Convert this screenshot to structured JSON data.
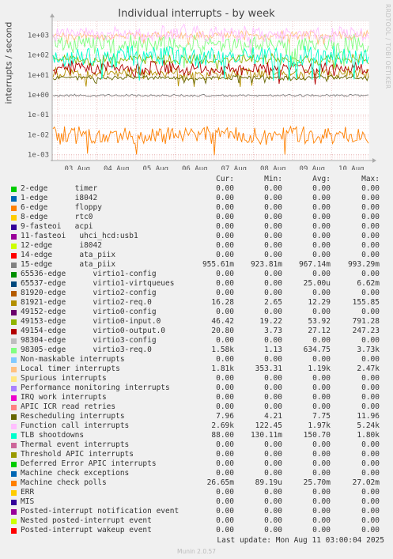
{
  "chart_data": {
    "type": "line",
    "title": "Individual interrupts - by week",
    "ylabel": "interrupts / second",
    "yscale": "log",
    "ylim": [
      0.0005,
      5000
    ],
    "yticks": [
      "1e-03",
      "1e-02",
      "1e-01",
      "1e+00",
      "1e+01",
      "1e+02",
      "1e+03"
    ],
    "xticks": [
      "03 Aug",
      "04 Aug",
      "05 Aug",
      "06 Aug",
      "07 Aug",
      "08 Aug",
      "09 Aug",
      "10 Aug"
    ],
    "grid": true,
    "legend_header": {
      "cur": "Cur:",
      "min": "Min:",
      "avg": "Avg:",
      "max": "Max:"
    },
    "series": [
      {
        "name": "2-edge      timer",
        "color": "#00cc00",
        "cur": "0.00",
        "min": "0.00",
        "avg": "0.00",
        "max": "0.00"
      },
      {
        "name": "1-edge      i8042",
        "color": "#0066b3",
        "cur": "0.00",
        "min": "0.00",
        "avg": "0.00",
        "max": "0.00"
      },
      {
        "name": "6-edge      floppy",
        "color": "#ff8000",
        "cur": "0.00",
        "min": "0.00",
        "avg": "0.00",
        "max": "0.00"
      },
      {
        "name": "8-edge      rtc0",
        "color": "#ffcc00",
        "cur": "0.00",
        "min": "0.00",
        "avg": "0.00",
        "max": "0.00"
      },
      {
        "name": "9-fasteoi   acpi",
        "color": "#330099",
        "cur": "0.00",
        "min": "0.00",
        "avg": "0.00",
        "max": "0.00"
      },
      {
        "name": "11-fasteoi   uhci_hcd:usb1",
        "color": "#990099",
        "cur": "0.00",
        "min": "0.00",
        "avg": "0.00",
        "max": "0.00"
      },
      {
        "name": "12-edge      i8042",
        "color": "#ccff00",
        "cur": "0.00",
        "min": "0.00",
        "avg": "0.00",
        "max": "0.00"
      },
      {
        "name": "14-edge      ata_piix",
        "color": "#ff0000",
        "cur": "0.00",
        "min": "0.00",
        "avg": "0.00",
        "max": "0.00"
      },
      {
        "name": "15-edge      ata_piix",
        "color": "#808080",
        "cur": "955.61m",
        "min": "923.81m",
        "avg": "967.14m",
        "max": "993.29m"
      },
      {
        "name": "65536-edge      virtio1-config",
        "color": "#008f00",
        "cur": "0.00",
        "min": "0.00",
        "avg": "0.00",
        "max": "0.00"
      },
      {
        "name": "65537-edge      virtio1-virtqueues",
        "color": "#00487d",
        "cur": "0.00",
        "min": "0.00",
        "avg": "25.00u",
        "max": "6.62m"
      },
      {
        "name": "81920-edge      virtio2-config",
        "color": "#b35a00",
        "cur": "0.00",
        "min": "0.00",
        "avg": "0.00",
        "max": "0.00"
      },
      {
        "name": "81921-edge      virtio2-req.0",
        "color": "#b38f00",
        "cur": "16.28",
        "min": "2.65",
        "avg": "12.29",
        "max": "155.85"
      },
      {
        "name": "49152-edge      virtio0-config",
        "color": "#6b006b",
        "cur": "0.00",
        "min": "0.00",
        "avg": "0.00",
        "max": "0.00"
      },
      {
        "name": "49153-edge      virtio0-input.0",
        "color": "#8fb300",
        "cur": "46.42",
        "min": "19.22",
        "avg": "53.92",
        "max": "791.28"
      },
      {
        "name": "49154-edge      virtio0-output.0",
        "color": "#b30000",
        "cur": "20.80",
        "min": "3.73",
        "avg": "27.12",
        "max": "247.23"
      },
      {
        "name": "98304-edge      virtio3-config",
        "color": "#bebebe",
        "cur": "0.00",
        "min": "0.00",
        "avg": "0.00",
        "max": "0.00"
      },
      {
        "name": "98305-edge      virtio3-req.0",
        "color": "#80ff80",
        "cur": "1.58k",
        "min": "1.13",
        "avg": "634.75",
        "max": "3.73k"
      },
      {
        "name": "Non-maskable interrupts",
        "color": "#80c9ff",
        "cur": "0.00",
        "min": "0.00",
        "avg": "0.00",
        "max": "0.00"
      },
      {
        "name": "Local timer interrupts",
        "color": "#ffc080",
        "cur": "1.81k",
        "min": "353.31",
        "avg": "1.19k",
        "max": "2.47k"
      },
      {
        "name": "Spurious interrupts",
        "color": "#ffe680",
        "cur": "0.00",
        "min": "0.00",
        "avg": "0.00",
        "max": "0.00"
      },
      {
        "name": "Performance monitoring interrupts",
        "color": "#aa80ff",
        "cur": "0.00",
        "min": "0.00",
        "avg": "0.00",
        "max": "0.00"
      },
      {
        "name": "IRQ work interrupts",
        "color": "#ee00cc",
        "cur": "0.00",
        "min": "0.00",
        "avg": "0.00",
        "max": "0.00"
      },
      {
        "name": "APIC ICR read retries",
        "color": "#ff8080",
        "cur": "0.00",
        "min": "0.00",
        "avg": "0.00",
        "max": "0.00"
      },
      {
        "name": "Rescheduling interrupts",
        "color": "#666600",
        "cur": "7.96",
        "min": "4.21",
        "avg": "7.75",
        "max": "11.96"
      },
      {
        "name": "Function call interrupts",
        "color": "#ffbfff",
        "cur": "2.69k",
        "min": "122.45",
        "avg": "1.97k",
        "max": "5.24k"
      },
      {
        "name": "TLB shootdowns",
        "color": "#00ffcc",
        "cur": "88.00",
        "min": "130.11m",
        "avg": "150.70",
        "max": "1.80k"
      },
      {
        "name": "Thermal event interrupts",
        "color": "#cc6699",
        "cur": "0.00",
        "min": "0.00",
        "avg": "0.00",
        "max": "0.00"
      },
      {
        "name": "Threshold APIC interrupts",
        "color": "#999900",
        "cur": "0.00",
        "min": "0.00",
        "avg": "0.00",
        "max": "0.00"
      },
      {
        "name": "Deferred Error APIC interrupts",
        "color": "#00cc00",
        "cur": "0.00",
        "min": "0.00",
        "avg": "0.00",
        "max": "0.00"
      },
      {
        "name": "Machine check exceptions",
        "color": "#0066b3",
        "cur": "0.00",
        "min": "0.00",
        "avg": "0.00",
        "max": "0.00"
      },
      {
        "name": "Machine check polls",
        "color": "#ff8000",
        "cur": "26.65m",
        "min": "89.19u",
        "avg": "25.70m",
        "max": "27.02m"
      },
      {
        "name": "ERR",
        "color": "#ffcc00",
        "cur": "0.00",
        "min": "0.00",
        "avg": "0.00",
        "max": "0.00"
      },
      {
        "name": "MIS",
        "color": "#330099",
        "cur": "0.00",
        "min": "0.00",
        "avg": "0.00",
        "max": "0.00"
      },
      {
        "name": "Posted-interrupt notification event",
        "color": "#990099",
        "cur": "0.00",
        "min": "0.00",
        "avg": "0.00",
        "max": "0.00"
      },
      {
        "name": "Nested posted-interrupt event",
        "color": "#ccff00",
        "cur": "0.00",
        "min": "0.00",
        "avg": "0.00",
        "max": "0.00"
      },
      {
        "name": "Posted-interrupt wakeup event",
        "color": "#ff0000",
        "cur": "0.00",
        "min": "0.00",
        "avg": "0.00",
        "max": "0.00"
      }
    ]
  },
  "footer": {
    "last_update": "Last update: Mon Aug 11 03:00:04 2025",
    "munin_version": "Munin 2.0.57",
    "vendor": "RRDTOOL / TOBI OETIKER"
  }
}
